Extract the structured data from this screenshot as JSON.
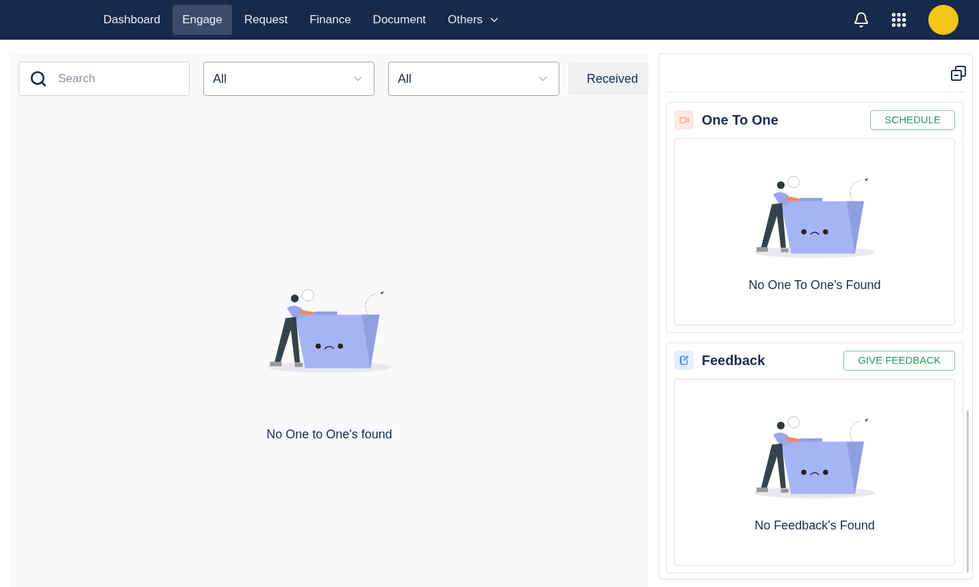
{
  "nav": {
    "items": [
      {
        "label": "Dashboard",
        "selected": false,
        "kind": "link"
      },
      {
        "label": "Engage",
        "selected": true,
        "kind": "link"
      },
      {
        "label": "Request",
        "selected": false,
        "kind": "link"
      },
      {
        "label": "Finance",
        "selected": false,
        "kind": "link"
      },
      {
        "label": "Document",
        "selected": false,
        "kind": "link"
      },
      {
        "label": "Others",
        "selected": false,
        "kind": "dropdown"
      }
    ]
  },
  "filters": {
    "search": {
      "placeholder": "Search"
    },
    "selects": [
      {
        "value": "All"
      },
      {
        "value": "All"
      }
    ],
    "button": "Received"
  },
  "empty_state": {
    "message": "No One to One's found"
  },
  "side_panel": {
    "cards": [
      {
        "kind": "video",
        "title": "One To One",
        "action": "SCHEDULE",
        "empty_message": "No One To One's Found"
      },
      {
        "kind": "feedback",
        "title": "Feedback",
        "action": "GIVE FEEDBACK",
        "empty_message": "No Feedback's Found"
      }
    ]
  }
}
